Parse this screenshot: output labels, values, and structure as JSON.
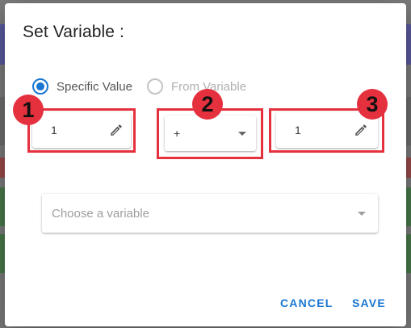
{
  "dialog": {
    "title": "Set Variable :",
    "radios": [
      {
        "label": "Specific Value",
        "selected": true
      },
      {
        "label": "From Variable",
        "selected": false
      }
    ],
    "left_value": "1",
    "operator": "+",
    "right_value": "1",
    "variable_select": {
      "placeholder": "Choose a variable"
    },
    "actions": {
      "cancel": "CANCEL",
      "save": "SAVE"
    }
  },
  "annotations": {
    "badge1": "1",
    "badge2": "2",
    "badge3": "3",
    "highlight_color": "#e5303e"
  },
  "colors": {
    "accent": "#1976d2"
  }
}
